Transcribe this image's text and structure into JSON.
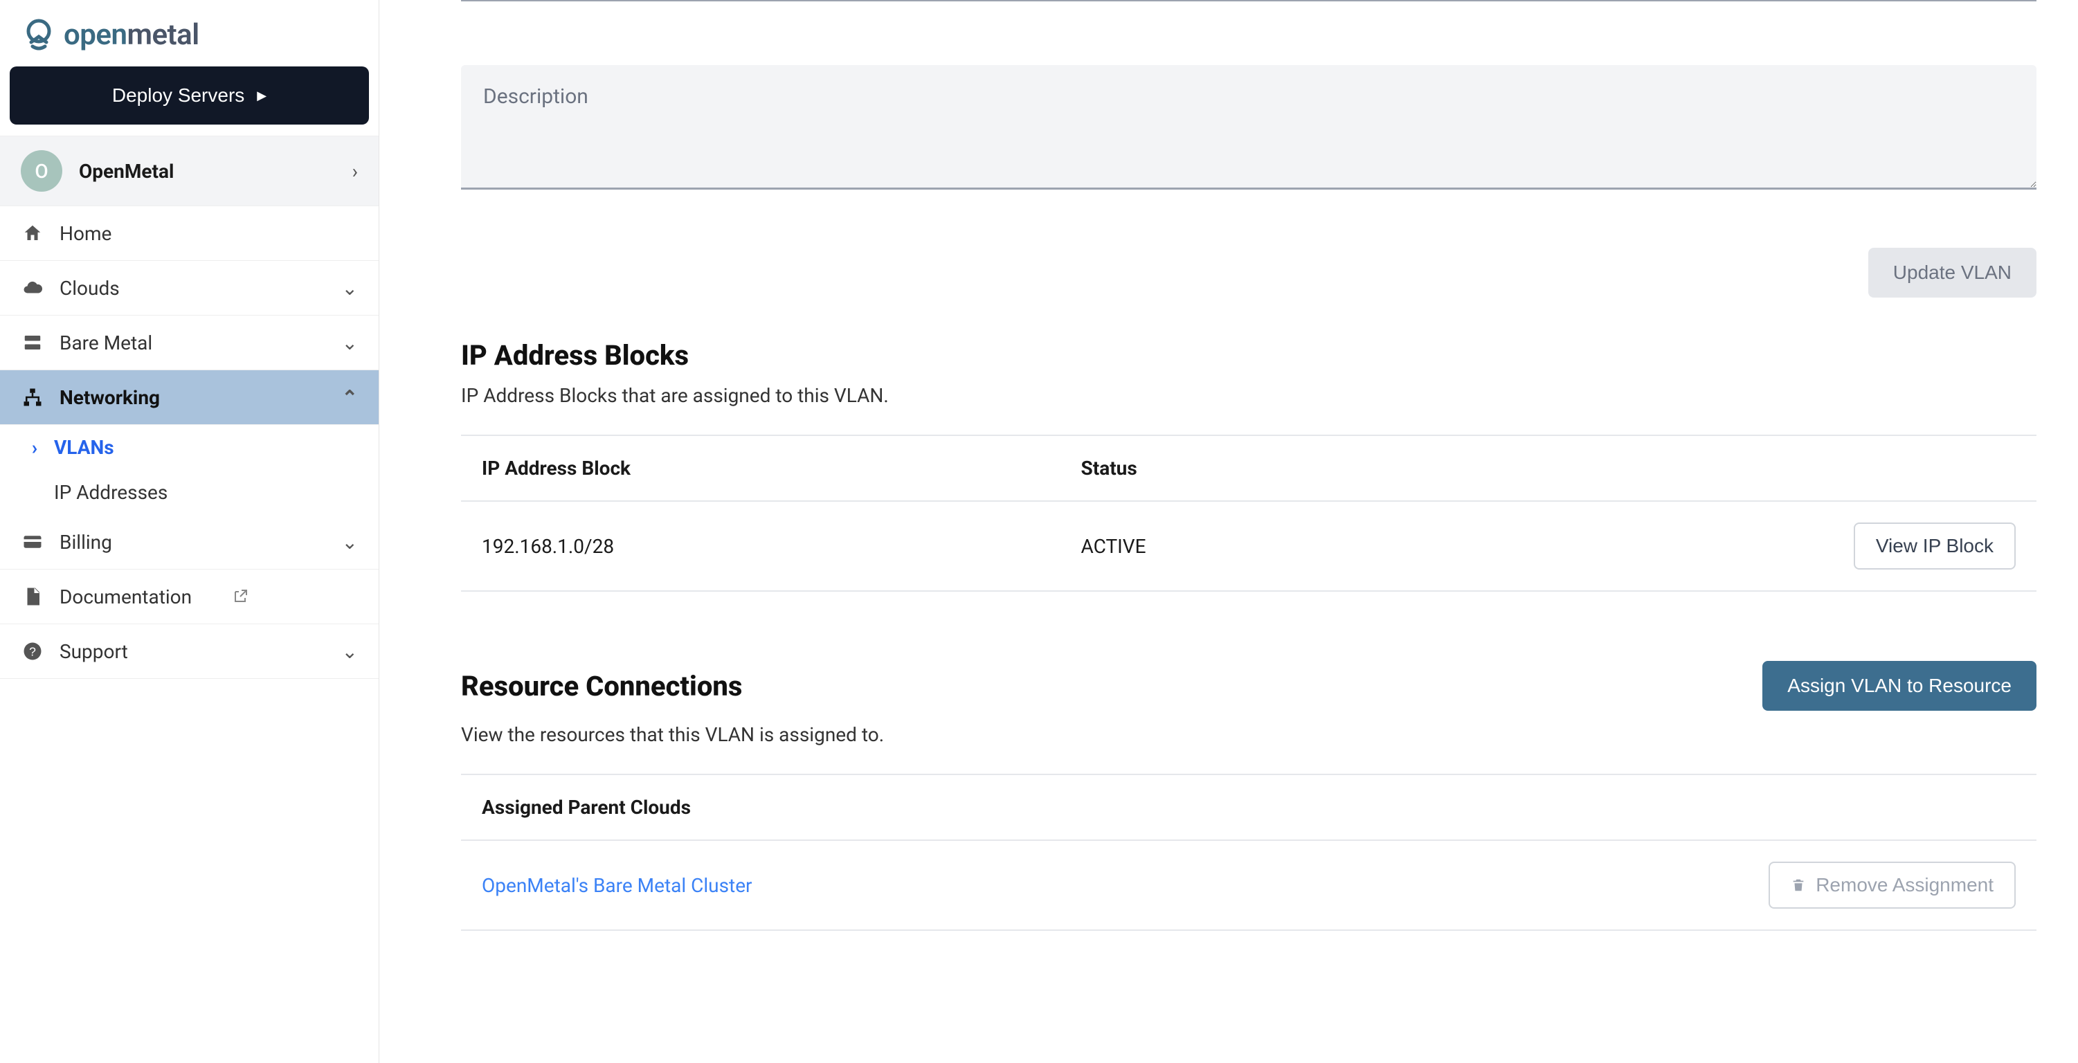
{
  "brand": {
    "open": "open",
    "metal": "metal"
  },
  "deploy_label": "Deploy Servers",
  "org": {
    "initial": "O",
    "name": "OpenMetal"
  },
  "nav": {
    "home": "Home",
    "clouds": "Clouds",
    "baremetal": "Bare Metal",
    "networking": "Networking",
    "billing": "Billing",
    "documentation": "Documentation",
    "support": "Support"
  },
  "subnav": {
    "vlans": "VLANs",
    "ip_addresses": "IP Addresses"
  },
  "form": {
    "description_placeholder": "Description",
    "update_label": "Update VLAN"
  },
  "ip_section": {
    "title": "IP Address Blocks",
    "subtitle": "IP Address Blocks that are assigned to this VLAN.",
    "col_block": "IP Address Block",
    "col_status": "Status",
    "rows": [
      {
        "block": "192.168.1.0/28",
        "status": "ACTIVE",
        "action": "View IP Block"
      }
    ]
  },
  "rc_section": {
    "title": "Resource Connections",
    "subtitle": "View the resources that this VLAN is assigned to.",
    "assign_label": "Assign VLAN to Resource",
    "col_parent": "Assigned Parent Clouds",
    "rows": [
      {
        "name": "OpenMetal's Bare Metal Cluster",
        "action": "Remove Assignment"
      }
    ]
  }
}
